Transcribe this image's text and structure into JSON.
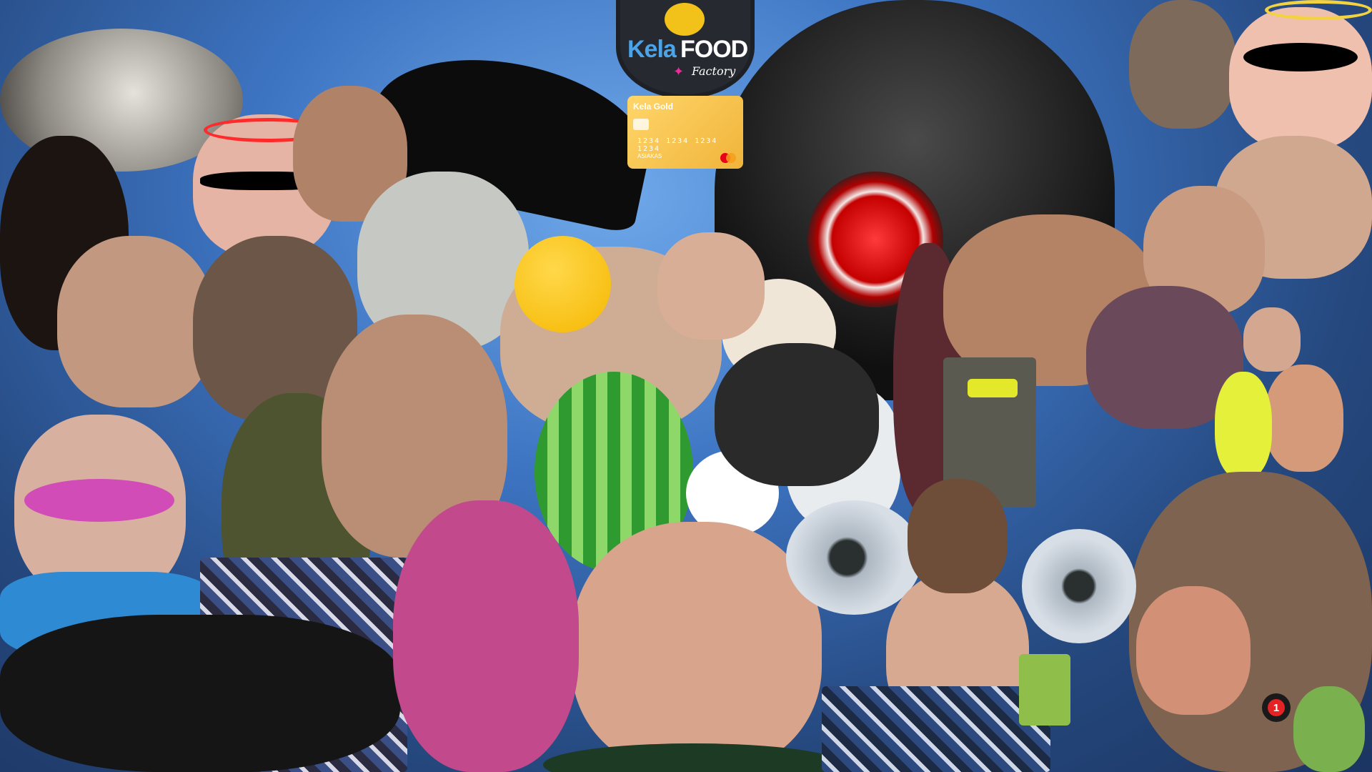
{
  "logo": {
    "brand_part1": "Kela",
    "brand_part2": "FOOD",
    "tagline": "Factory"
  },
  "card": {
    "brand": "Kela Gold",
    "number": "1234 1234 1234 1234",
    "holder": "ASIAKAS"
  },
  "notification": {
    "count": "1",
    "color": "#e42424"
  },
  "colors": {
    "background": "#3d74c2",
    "logo_accent": "#f2c21a",
    "logo_kela": "#4ba3e8"
  }
}
